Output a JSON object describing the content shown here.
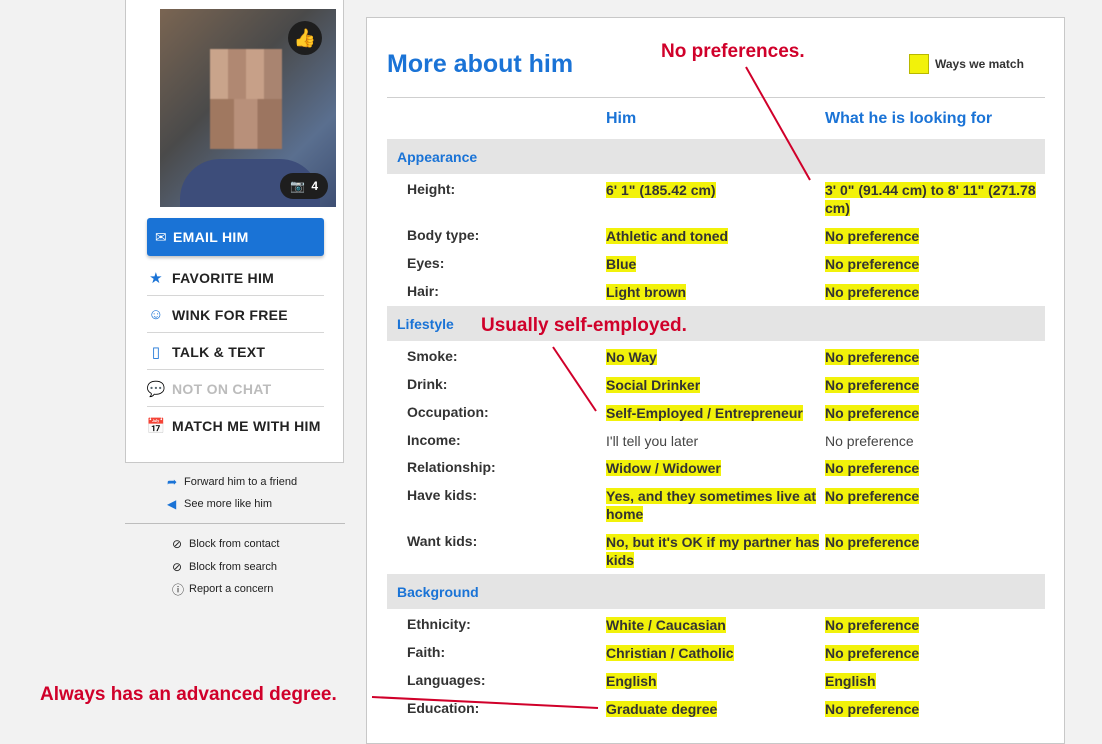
{
  "sidebar": {
    "photo_count": "4",
    "email_label": "EMAIL HIM",
    "actions": [
      {
        "label": "FAVORITE HIM"
      },
      {
        "label": "WINK FOR FREE"
      },
      {
        "label": "TALK & TEXT"
      },
      {
        "label": "NOT ON CHAT"
      },
      {
        "label": "MATCH ME WITH HIM"
      }
    ],
    "links": [
      "Forward him to a friend",
      "See more like him"
    ],
    "links2": [
      "Block from contact",
      "Block from search",
      "Report a concern"
    ]
  },
  "main": {
    "title": "More about him",
    "legend": "Ways we match",
    "col_him": "Him",
    "col_want": "What he is looking for",
    "sections": {
      "appearance": "Appearance",
      "lifestyle": "Lifestyle",
      "background": "Background"
    },
    "rows": {
      "height": {
        "label": "Height:",
        "him": "6' 1\" (185.42 cm)",
        "want": "3' 0\" (91.44 cm) to 8' 11\" (271.78 cm)"
      },
      "body": {
        "label": "Body type:",
        "him": "Athletic and toned",
        "want": "No preference"
      },
      "eyes": {
        "label": "Eyes:",
        "him": "Blue",
        "want": "No preference"
      },
      "hair": {
        "label": "Hair:",
        "him": "Light brown",
        "want": "No preference"
      },
      "smoke": {
        "label": "Smoke:",
        "him": "No Way",
        "want": "No preference"
      },
      "drink": {
        "label": "Drink:",
        "him": "Social Drinker",
        "want": "No preference"
      },
      "occupation": {
        "label": "Occupation:",
        "him": "Self-Employed / Entrepreneur",
        "want": "No preference"
      },
      "income": {
        "label": "Income:",
        "him": "I'll tell you later",
        "want": "No preference"
      },
      "relationship": {
        "label": "Relationship:",
        "him": "Widow / Widower",
        "want": "No preference"
      },
      "havekids": {
        "label": "Have kids:",
        "him": "Yes, and they sometimes live at home",
        "want": "No preference"
      },
      "wantkids": {
        "label": "Want kids:",
        "him": "No, but it's OK if my partner has kids",
        "want": "No preference"
      },
      "ethnicity": {
        "label": "Ethnicity:",
        "him": "White / Caucasian",
        "want": "No preference"
      },
      "faith": {
        "label": "Faith:",
        "him": "Christian / Catholic",
        "want": "No preference"
      },
      "languages": {
        "label": "Languages:",
        "him": "English",
        "want": "English"
      },
      "education": {
        "label": "Education:",
        "him": "Graduate degree",
        "want": "No preference"
      }
    }
  },
  "annotations": {
    "no_pref": "No preferences.",
    "self_emp": "Usually self-employed.",
    "degree": "Always has an advanced degree."
  },
  "colors": {
    "accent": "#1a73d6",
    "match_highlight": "#f2f20a",
    "annotation": "#d0002a"
  }
}
